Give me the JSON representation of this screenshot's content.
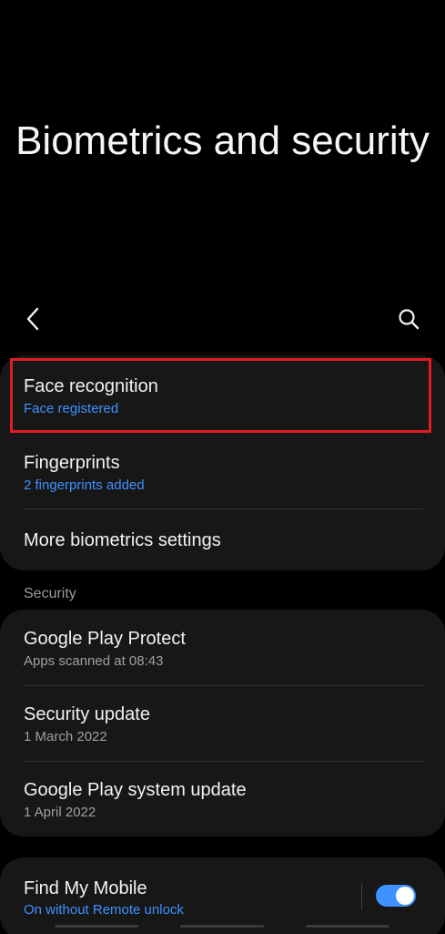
{
  "header": {
    "title": "Biometrics and security"
  },
  "toolbar": {
    "back_icon": "chevron-left-icon",
    "search_icon": "search-icon"
  },
  "biometrics": {
    "items": [
      {
        "title": "Face recognition",
        "subtitle": "Face registered"
      },
      {
        "title": "Fingerprints",
        "subtitle": "2 fingerprints added"
      },
      {
        "title": "More biometrics settings"
      }
    ]
  },
  "security": {
    "header": "Security",
    "items": [
      {
        "title": "Google Play Protect",
        "subtitle": "Apps scanned at 08:43"
      },
      {
        "title": "Security update",
        "subtitle": "1 March 2022"
      },
      {
        "title": "Google Play system update",
        "subtitle": "1 April 2022"
      }
    ]
  },
  "find_my_mobile": {
    "title": "Find My Mobile",
    "subtitle": "On without Remote unlock",
    "enabled": true
  },
  "colors": {
    "background": "#000000",
    "card": "#171717",
    "accent": "#3e91ff",
    "highlight": "#e01b24"
  }
}
